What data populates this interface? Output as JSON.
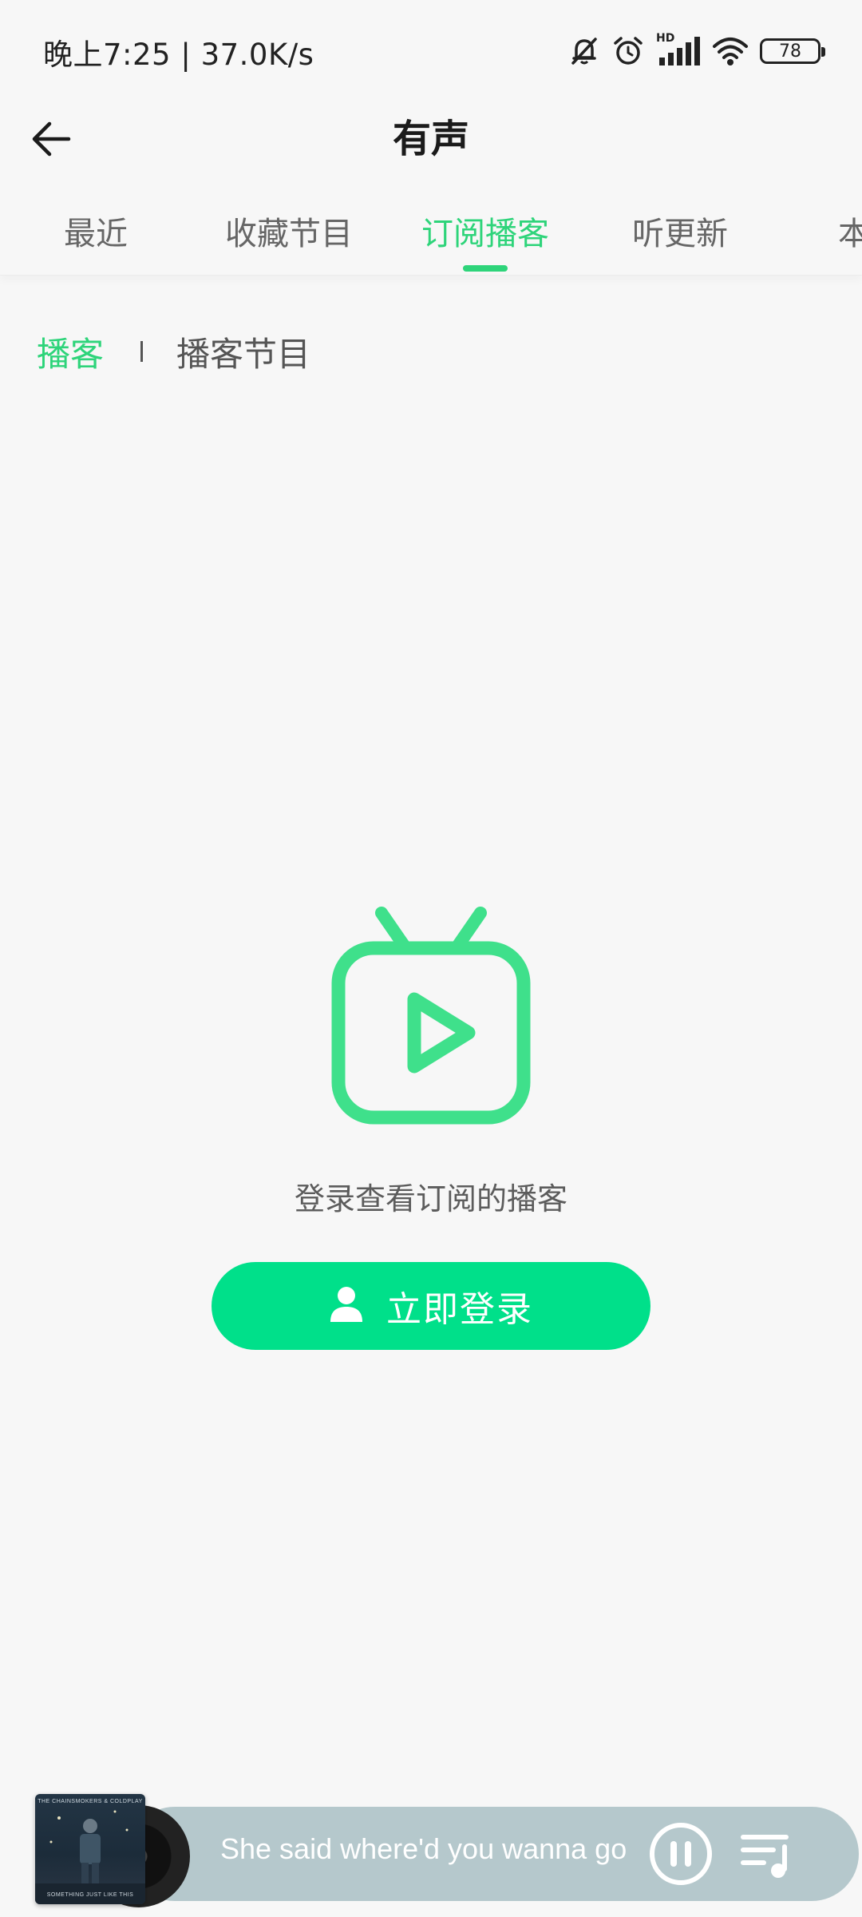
{
  "status_bar": {
    "time_speed": "晚上7:25 | 37.0K/s",
    "signal_label": "HD",
    "battery": "78"
  },
  "header": {
    "title": "有声"
  },
  "tabs": [
    {
      "label": "最近",
      "active": false
    },
    {
      "label": "收藏节目",
      "active": false
    },
    {
      "label": "订阅播客",
      "active": true
    },
    {
      "label": "听更新",
      "active": false
    },
    {
      "label": "本",
      "active": false
    }
  ],
  "subtabs": [
    {
      "label": "播客",
      "active": true
    },
    {
      "label": "播客节目",
      "active": false
    }
  ],
  "empty_state": {
    "icon": "tv-play-icon",
    "message": "登录查看订阅的播客",
    "button_label": "立即登录",
    "button_icon": "user-icon"
  },
  "mini_player": {
    "text": "She said where'd you wanna go",
    "cover_top": "THE CHAINSMOKERS & COLDPLAY",
    "cover_bottom": "SOMETHING JUST LIKE THIS"
  },
  "colors": {
    "accent": "#2ed47a",
    "button": "#00e08a",
    "player_bar": "#b5c8cc"
  }
}
